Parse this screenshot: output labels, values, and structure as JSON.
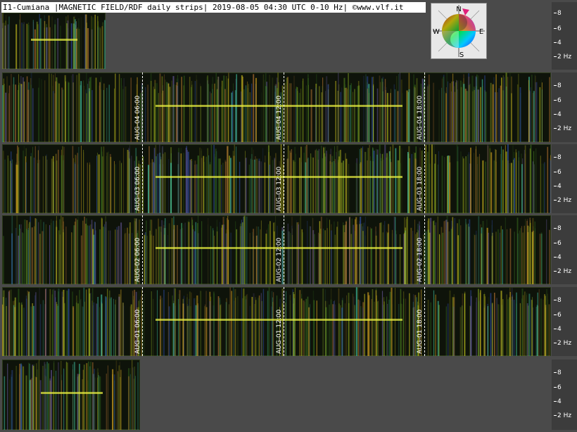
{
  "header": {
    "title": "I1-Cumiana |MAGNETIC FIELD/RDF daily strips| 2019-08-05 04:30 UTC 0-10 Hz| ©www.vlf.it"
  },
  "compass": {
    "n": "N",
    "e": "E",
    "s": "S",
    "w": "W"
  },
  "scale_labels": [
    "8",
    "6",
    "4",
    "2 Hz"
  ],
  "strips": [
    {
      "id": "aug04",
      "labels": [
        "AUG-04 06:00",
        "AUG-04 12:00",
        "AUG-04 18:00"
      ]
    },
    {
      "id": "aug03",
      "labels": [
        "AUG-03 06:00",
        "AUG-03 12:00",
        "AUG-03 18:00"
      ]
    },
    {
      "id": "aug02",
      "labels": [
        "AUG-02 06:00",
        "AUG-02 12:00",
        "AUG-02 18:00"
      ]
    },
    {
      "id": "aug01",
      "labels": [
        "AUG-01 06:00",
        "AUG-01 12:00",
        "AUG-01 18:00"
      ]
    }
  ],
  "colors": {
    "background": "#4a4a4a",
    "signal": "#d8e030",
    "noise_green": "#2e5a1a",
    "noise_purple": "#7050c0"
  }
}
